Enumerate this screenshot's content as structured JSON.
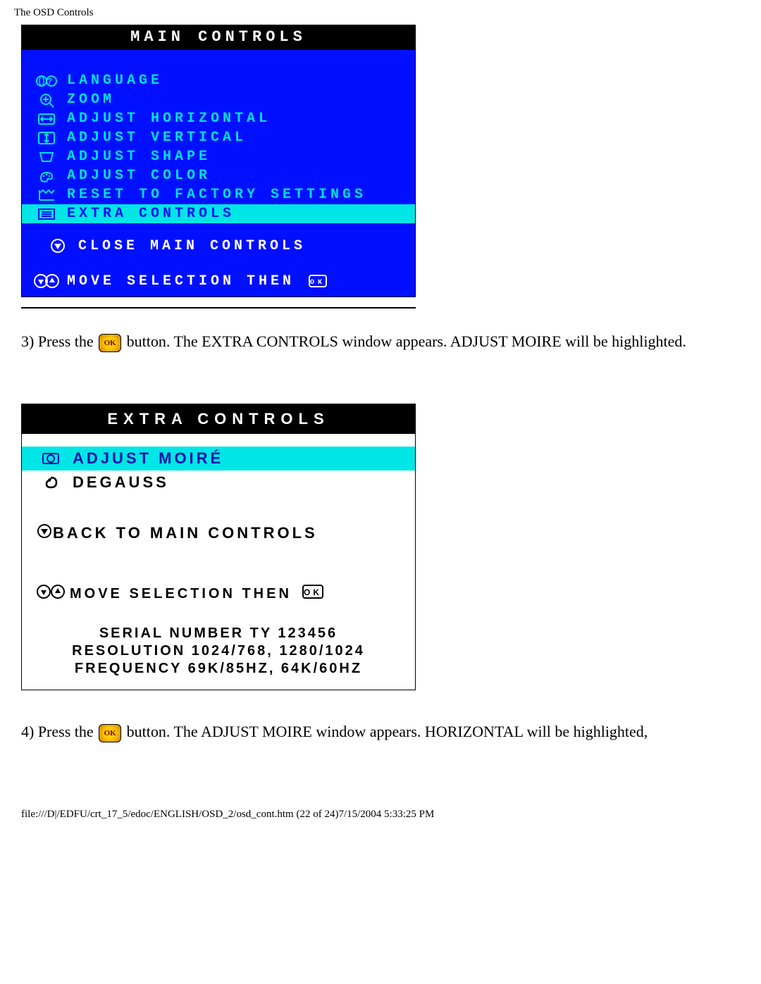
{
  "page": {
    "header": "The OSD Controls",
    "footer": "file:///D|/EDFU/crt_17_5/edoc/ENGLISH/OSD_2/osd_cont.htm (22 of 24)7/15/2004 5:33:25 PM"
  },
  "main_controls": {
    "title": "MAIN CONTROLS",
    "items": [
      {
        "icon": "globe-q-icon",
        "label": "LANGUAGE"
      },
      {
        "icon": "zoom-icon",
        "label": "ZOOM"
      },
      {
        "icon": "horiz-icon",
        "label": "ADJUST HORIZONTAL"
      },
      {
        "icon": "vert-icon",
        "label": "ADJUST VERTICAL"
      },
      {
        "icon": "shape-icon",
        "label": "ADJUST SHAPE"
      },
      {
        "icon": "color-icon",
        "label": "ADJUST COLOR"
      },
      {
        "icon": "reset-icon",
        "label": "RESET TO FACTORY SETTINGS"
      },
      {
        "icon": "extra-icon",
        "label": "EXTRA CONTROLS",
        "highlighted": true
      }
    ],
    "close": {
      "icon": "down-circle-icon",
      "label": "CLOSE MAIN CONTROLS"
    },
    "footer_hint": {
      "icons": "up-down-icon",
      "label": "MOVE SELECTION THEN",
      "tail_icon": "ok-box-icon"
    }
  },
  "step3": {
    "pre": "3) Press the ",
    "button": "OK",
    "post": " button. The EXTRA CONTROLS window appears. ADJUST MOIRE will be highlighted."
  },
  "extra_controls": {
    "title": "EXTRA CONTROLS",
    "items": [
      {
        "icon": "moire-icon",
        "label": "ADJUST MOIRÉ",
        "highlighted": true
      },
      {
        "icon": "degauss-icon",
        "label": "DEGAUSS"
      }
    ],
    "back": {
      "icon": "down-circle-icon",
      "label": "BACK TO MAIN CONTROLS"
    },
    "move_hint": {
      "icons": "up-down-icon",
      "label": "MOVE SELECTION THEN",
      "tail_icon": "ok-box-icon"
    },
    "info": {
      "serial": "SERIAL NUMBER TY 123456",
      "resolution": "RESOLUTION 1024/768, 1280/1024",
      "frequency": "FREQUENCY 69K/85HZ, 64K/60HZ"
    }
  },
  "step4": {
    "pre": "4) Press the ",
    "button": "OK",
    "post": " button. The ADJUST MOIRE window appears. HORIZONTAL will be highlighted,"
  }
}
